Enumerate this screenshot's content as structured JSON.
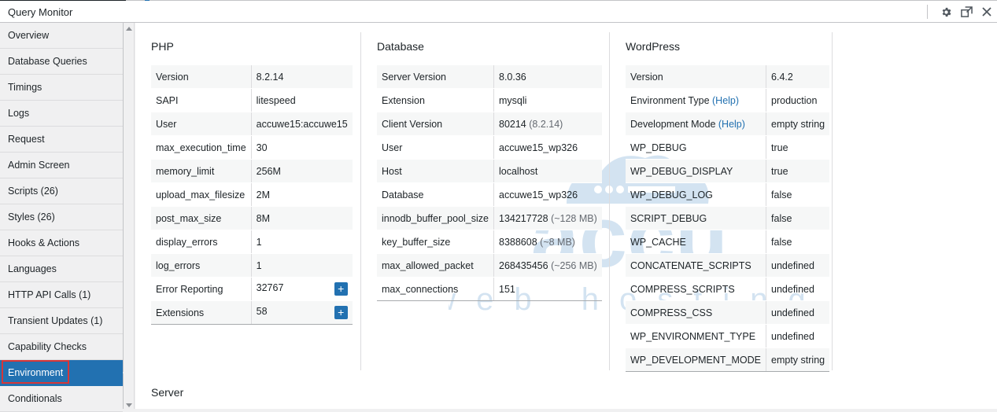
{
  "window": {
    "title": "Query Monitor",
    "actions": [
      {
        "icon": "gear-icon",
        "glyph": "⚙"
      },
      {
        "icon": "popout-icon",
        "glyph": "⧉"
      },
      {
        "icon": "close-icon",
        "glyph": "✕"
      }
    ]
  },
  "sidebar": {
    "items": [
      {
        "label": "Overview"
      },
      {
        "label": "Database Queries"
      },
      {
        "label": "Timings"
      },
      {
        "label": "Logs"
      },
      {
        "label": "Request"
      },
      {
        "label": "Admin Screen"
      },
      {
        "label": "Scripts (26)"
      },
      {
        "label": "Styles (26)"
      },
      {
        "label": "Hooks & Actions"
      },
      {
        "label": "Languages"
      },
      {
        "label": "HTTP API Calls (1)"
      },
      {
        "label": "Transient Updates (1)"
      },
      {
        "label": "Capability Checks"
      },
      {
        "label": "Environment",
        "active": true
      },
      {
        "label": "Conditionals"
      }
    ]
  },
  "php": {
    "heading": "PHP",
    "rows": [
      {
        "key": "Version",
        "value": "8.2.14"
      },
      {
        "key": "SAPI",
        "value": "litespeed"
      },
      {
        "key": "User",
        "value": "accuwe15:accuwe15"
      },
      {
        "key": "max_execution_time",
        "value": "30"
      },
      {
        "key": "memory_limit",
        "value": "256M"
      },
      {
        "key": "upload_max_filesize",
        "value": "2M"
      },
      {
        "key": "post_max_size",
        "value": "8M"
      },
      {
        "key": "display_errors",
        "value": "1"
      },
      {
        "key": "log_errors",
        "value": "1"
      },
      {
        "key": "Error Reporting",
        "value": "32767",
        "expand": "+"
      },
      {
        "key": "Extensions",
        "value": "58",
        "expand": "+"
      }
    ]
  },
  "database": {
    "heading": "Database",
    "rows": [
      {
        "key": "Server Version",
        "value": "8.0.36"
      },
      {
        "key": "Extension",
        "value": "mysqli"
      },
      {
        "key": "Client Version",
        "value": "80214",
        "note": "(8.2.14)"
      },
      {
        "key": "User",
        "value": "accuwe15_wp326"
      },
      {
        "key": "Host",
        "value": "localhost"
      },
      {
        "key": "Database",
        "value": "accuwe15_wp326"
      },
      {
        "key": "innodb_buffer_pool_size",
        "value": "134217728",
        "note": "(~128 MB)"
      },
      {
        "key": "key_buffer_size",
        "value": "8388608",
        "note": "(~8 MB)"
      },
      {
        "key": "max_allowed_packet",
        "value": "268435456",
        "note": "(~256 MB)"
      },
      {
        "key": "max_connections",
        "value": "151"
      }
    ]
  },
  "wordpress": {
    "heading": "WordPress",
    "rows": [
      {
        "key": "Version",
        "value": "6.4.2"
      },
      {
        "key": "Environment Type",
        "help": "(Help)",
        "value": "production"
      },
      {
        "key": "Development Mode",
        "help": "(Help)",
        "value": "empty string"
      },
      {
        "key": "WP_DEBUG",
        "value": "true"
      },
      {
        "key": "WP_DEBUG_DISPLAY",
        "value": "true"
      },
      {
        "key": "WP_DEBUG_LOG",
        "value": "false"
      },
      {
        "key": "SCRIPT_DEBUG",
        "value": "false"
      },
      {
        "key": "WP_CACHE",
        "value": "false"
      },
      {
        "key": "CONCATENATE_SCRIPTS",
        "value": "undefined"
      },
      {
        "key": "COMPRESS_SCRIPTS",
        "value": "undefined"
      },
      {
        "key": "COMPRESS_CSS",
        "value": "undefined"
      },
      {
        "key": "WP_ENVIRONMENT_TYPE",
        "value": "undefined"
      },
      {
        "key": "WP_DEVELOPMENT_MODE",
        "value": "empty string"
      }
    ]
  },
  "server": {
    "heading": "Server"
  },
  "watermark": {
    "brand": "accu",
    "tagline": "web hosting"
  },
  "colors": {
    "accent": "#2271b1",
    "highlight": "#d63638"
  }
}
